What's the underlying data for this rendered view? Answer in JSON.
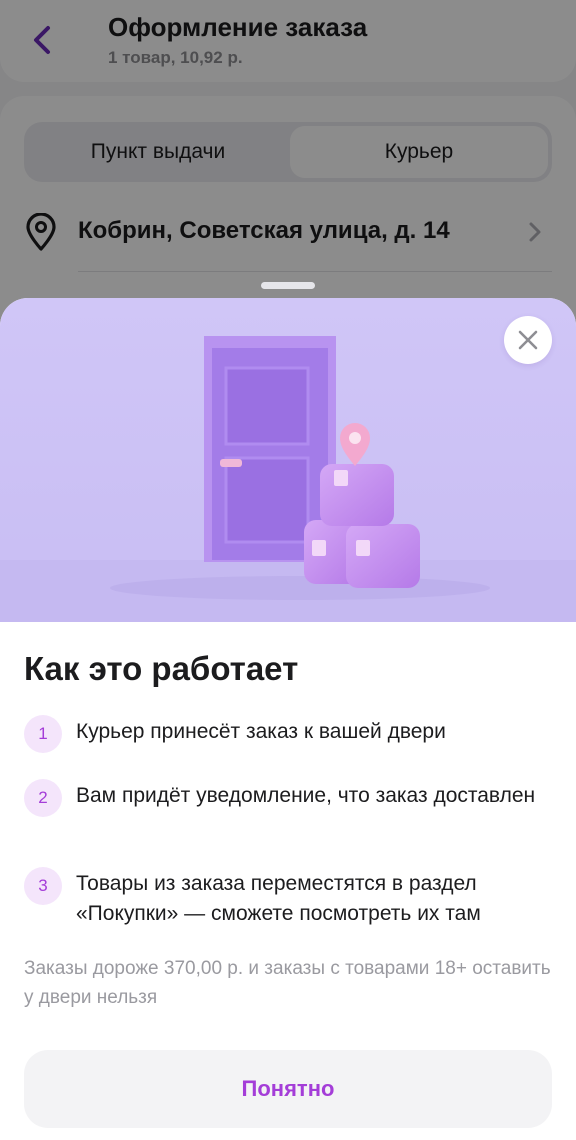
{
  "header": {
    "title": "Оформление заказа",
    "subtitle": "1 товар, 10,92 р.",
    "back_icon": "chevron-left-icon"
  },
  "delivery_tabs": [
    {
      "label": "Пункт выдачи",
      "selected": false
    },
    {
      "label": "Курьер",
      "selected": true
    }
  ],
  "address": {
    "icon": "location-pin-icon",
    "text": "Кобрин, Советская улица, д. 14",
    "chevron_icon": "chevron-right-icon"
  },
  "sheet": {
    "close_icon": "close-icon",
    "title": "Как это работает",
    "steps": [
      {
        "num": "1",
        "text": "Курьер принесёт заказ к вашей двери"
      },
      {
        "num": "2",
        "text": "Вам придёт уведомление, что заказ доставлен"
      },
      {
        "num": "3",
        "text": "Товары из заказа переместятся в раздел «Покупки» — сможете посмотреть их там"
      }
    ],
    "note": "Заказы дороже 370,00 р. и заказы с товарами 18+ оставить у двери нельзя",
    "confirm_label": "Понятно"
  },
  "colors": {
    "accent": "#a43dd8",
    "back_arrow": "#6a2ab8",
    "illustration_bg": "#d2c8f6",
    "door": "#a07ae8"
  }
}
